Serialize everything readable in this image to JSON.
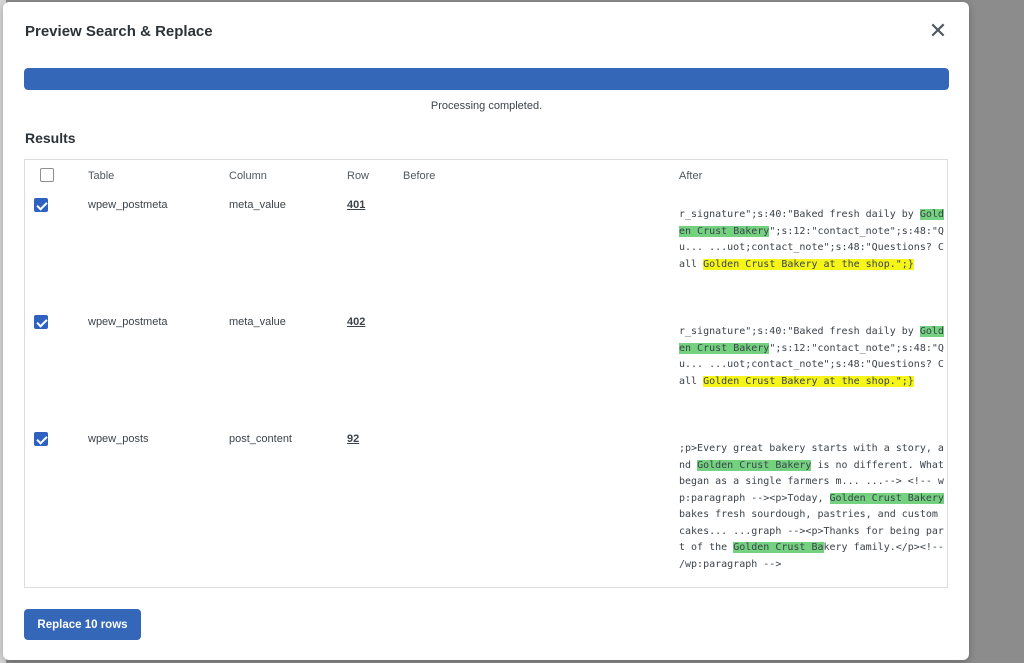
{
  "modal": {
    "title": "Preview Search & Replace",
    "close_icon": "close-icon",
    "progress_percent": 100,
    "status_text": "Processing completed.",
    "results_heading": "Results",
    "replace_button": "Replace 10 rows"
  },
  "table": {
    "headers": [
      "Table",
      "Column",
      "Row",
      "Before",
      "After"
    ],
    "rows": [
      {
        "checked": true,
        "table": "wpew_postmeta",
        "column": "meta_value",
        "row": "401",
        "before": "",
        "after": {
          "p1": "r_signature\";s:40:\"Baked fresh daily by ",
          "h1": "Golden Crust ",
          "h2": "Bakery",
          "p2": "\";s:12:\"contact_note\";s:48:\"Qu... ...uot;contact_note\";s:48:\"Questions? Call ",
          "h3": "Golden Crust Bakery at the shop.\";}"
        }
      },
      {
        "checked": true,
        "table": "wpew_postmeta",
        "column": "meta_value",
        "row": "402",
        "before": "",
        "after": {
          "p1": "r_signature\";s:40:\"Baked fresh daily by ",
          "h1": "Golden Crust ",
          "h2": "Bakery",
          "p2": "\";s:12:\"contact_note\";s:48:\"Qu... ...uot;contact_note\";s:48:\"Questions? Call ",
          "h3": "Golden Crust Bakery at the shop.\";}"
        }
      },
      {
        "checked": true,
        "table": "wpew_posts",
        "column": "post_content",
        "row": "92",
        "before": "",
        "after": {
          "p1": ";p>Every great bakery starts with a story, and ",
          "h1": "Golden Crust Bakery",
          "p2": " is no different. What began as a single farmers m... ...--> <!-- wp:paragraph --><p>Today, ",
          "h2": "Golden Crust Bakery",
          "p3": " bakes fresh sourdough, pastries, and custom cakes... ...graph --><p>Thanks for being part of the ",
          "h3": "Golden Crust Ba",
          "p4": "kery family.</p><!-- /wp:paragraph -->"
        }
      }
    ]
  },
  "colors": {
    "accent": "#3467b8",
    "highlight_green": "#73d180",
    "highlight_yellow": "#f5f518"
  }
}
